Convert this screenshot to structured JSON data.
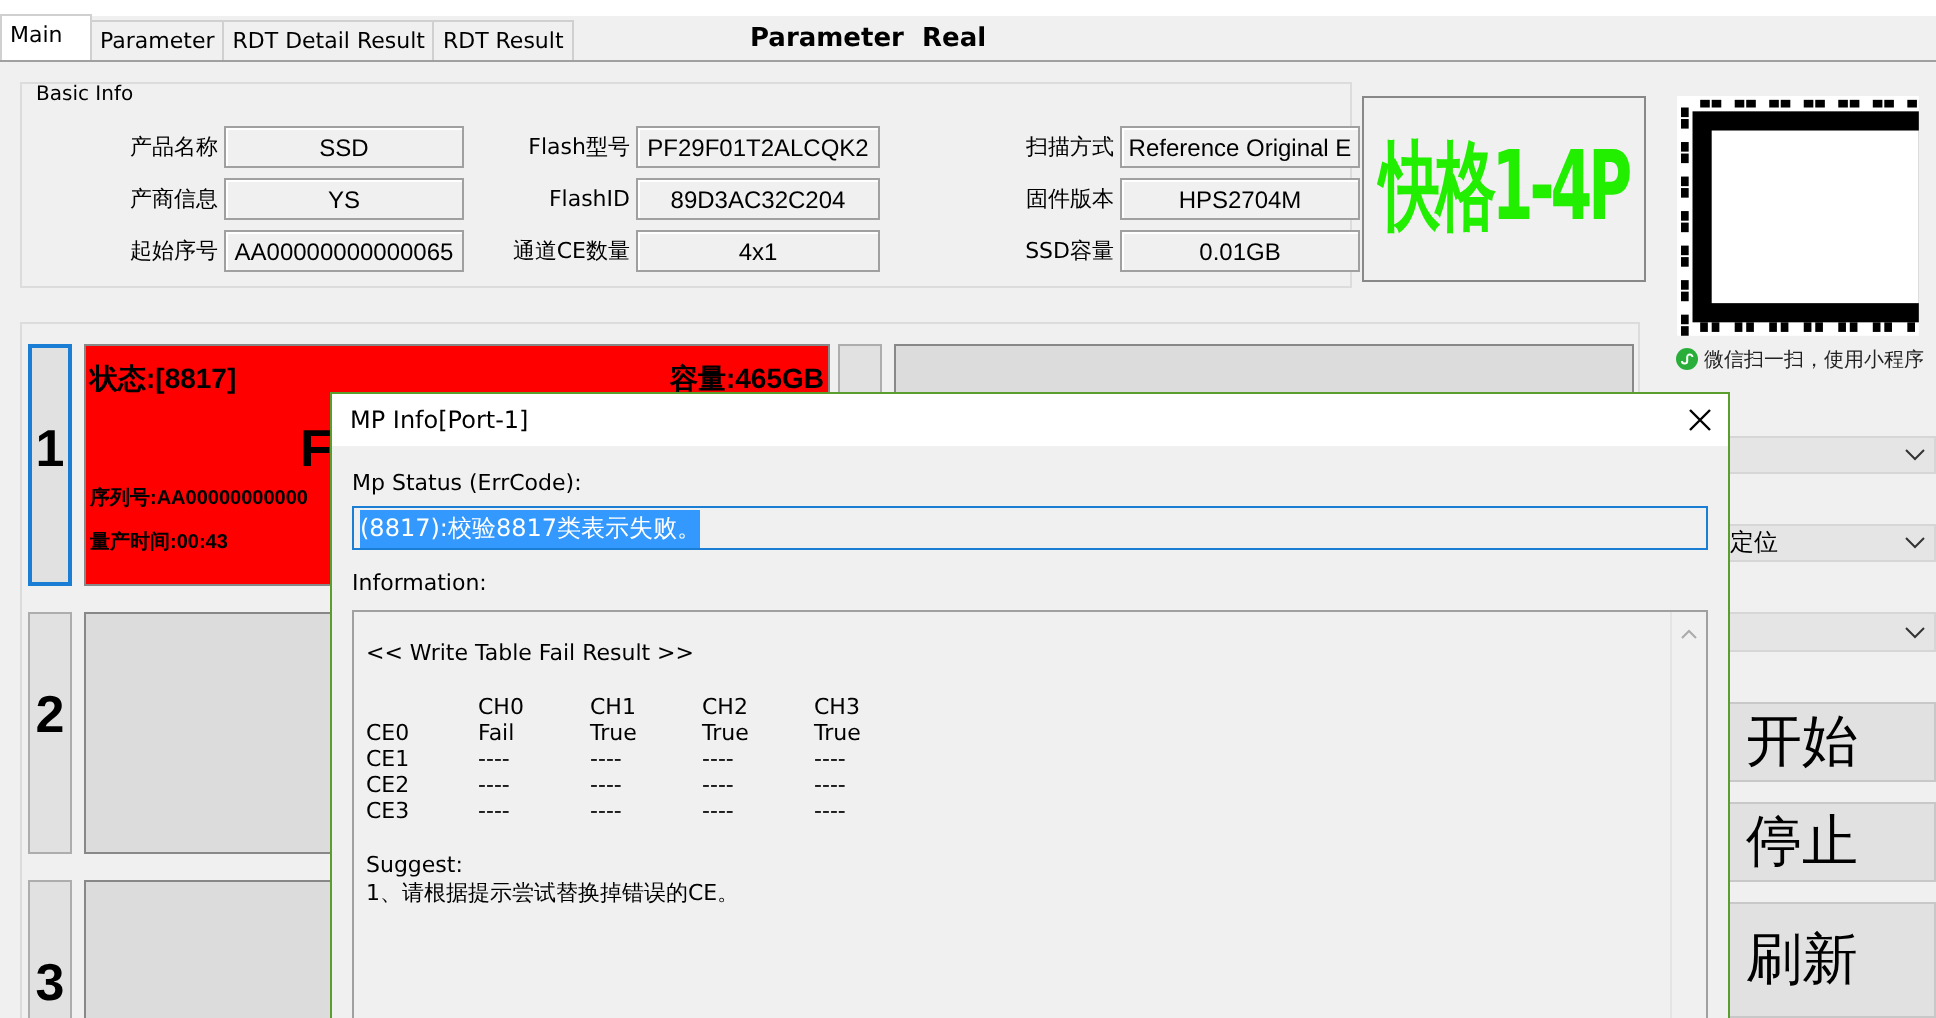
{
  "tabs": [
    {
      "label": "Main",
      "selected": true
    },
    {
      "label": "Parameter",
      "selected": false
    },
    {
      "label": "RDT Detail Result",
      "selected": false
    },
    {
      "label": "RDT Result",
      "selected": false
    }
  ],
  "header_title": "Parameter  Real",
  "basic_info": {
    "title": "Basic Info",
    "fields": [
      {
        "label": "产品名称",
        "value": "SSD"
      },
      {
        "label": "Flash型号",
        "value": "PF29F01T2ALCQK2"
      },
      {
        "label": "扫描方式",
        "value": "Reference Original E"
      },
      {
        "label": "产商信息",
        "value": "YS"
      },
      {
        "label": "FlashID",
        "value": "89D3AC32C204"
      },
      {
        "label": "固件版本",
        "value": "HPS2704M"
      },
      {
        "label": "起始序号",
        "value": "AA00000000000065"
      },
      {
        "label": "通道CE数量",
        "value": "4x1"
      },
      {
        "label": "SSD容量",
        "value": "0.01GB"
      }
    ]
  },
  "logo": "快格1-4P",
  "qr": {
    "caption": "微信扫一扫，使用小程序"
  },
  "ports": [
    {
      "number": "1",
      "selected": true,
      "kind": "fail",
      "status": "状态:[8817]",
      "capacity": "容量:465GB",
      "result": "F",
      "serial": "序列号:AA00000000000",
      "time": "量产时间:00:43"
    },
    {
      "number": "2",
      "selected": false,
      "kind": "idle"
    },
    {
      "number": "3",
      "selected": false,
      "kind": "idle"
    }
  ],
  "dropdowns": [
    {
      "kind": "blank"
    },
    {
      "kind": "text",
      "value": "定位"
    },
    {
      "kind": "blank"
    }
  ],
  "buttons": [
    "开始",
    "停止",
    "刷新"
  ],
  "dialog": {
    "title": "MP Info[Port-1]",
    "status_label": "Mp Status (ErrCode):",
    "status_value": "(8817):校验8817类表示失败。",
    "info_label": "Information:",
    "info": {
      "heading": "<< Write Table Fail Result >>",
      "columns": [
        "CH0",
        "CH1",
        "CH2",
        "CH3"
      ],
      "rows": [
        {
          "ce": "CE0",
          "cells": [
            "Fail",
            "True",
            "True",
            "True"
          ]
        },
        {
          "ce": "CE1",
          "cells": [
            "----",
            "----",
            "----",
            "----"
          ]
        },
        {
          "ce": "CE2",
          "cells": [
            "----",
            "----",
            "----",
            "----"
          ]
        },
        {
          "ce": "CE3",
          "cells": [
            "----",
            "----",
            "----",
            "----"
          ]
        }
      ],
      "suggest_label": "Suggest:",
      "suggestions": [
        "1、请根据提示尝试替换掉错误的CE。"
      ]
    }
  }
}
